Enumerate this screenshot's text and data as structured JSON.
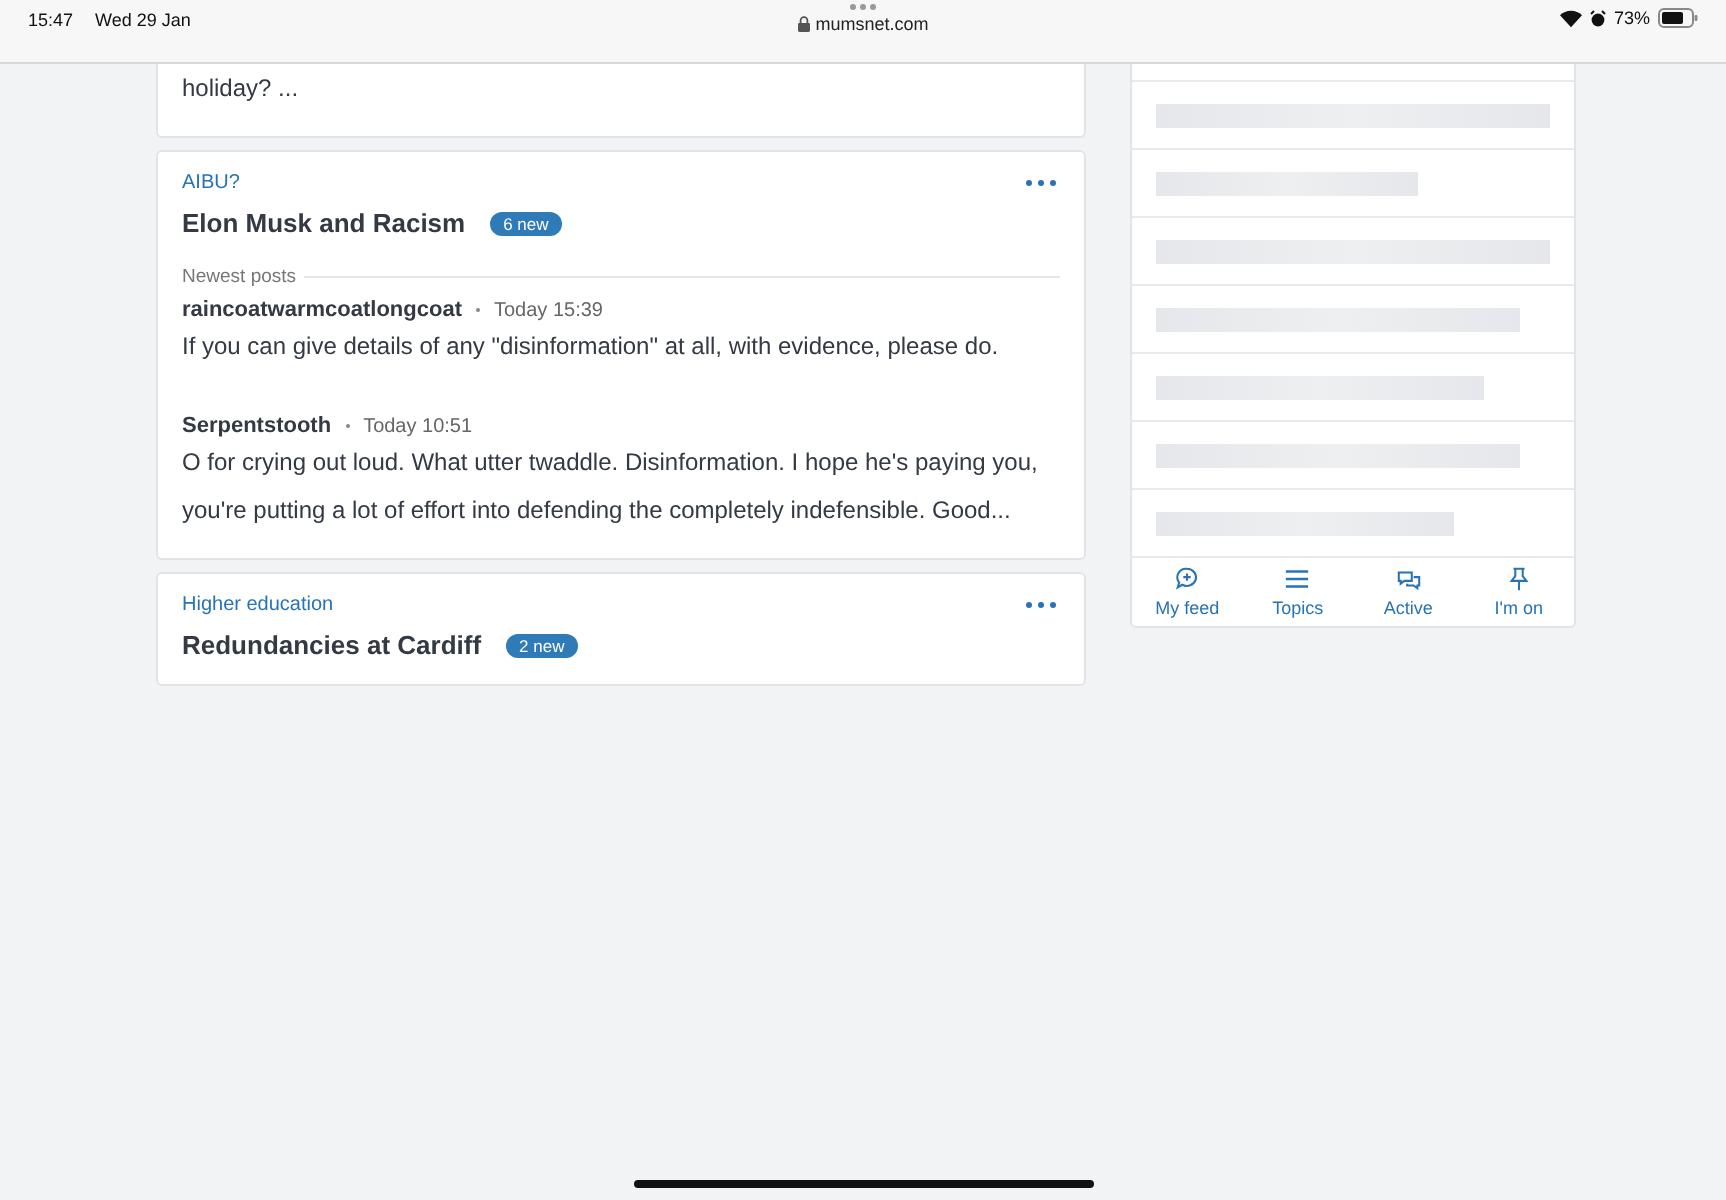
{
  "status_bar": {
    "time": "15:47",
    "date": "Wed 29 Jan",
    "url": "mumsnet.com",
    "battery": "73%"
  },
  "threads": [
    {
      "partial_text": "holiday? ..."
    },
    {
      "topic": "AIBU?",
      "title": "Elon Musk and Racism",
      "badge": "6 new",
      "section_label": "Newest posts",
      "posts": [
        {
          "author": "raincoatwarmcoatlongcoat",
          "time": "Today 15:39",
          "text": "If you can give details of any \"disinformation\" at all, with evidence, please do."
        },
        {
          "author": "Serpentstooth",
          "time": "Today 10:51",
          "text": "O for crying out loud. What utter twaddle. Disinformation. I hope he's paying you, you're putting a lot of effort into defending the completely indefensible. Good..."
        }
      ]
    },
    {
      "topic": "Higher education",
      "title": "Redundancies at Cardiff",
      "badge": "2 new"
    }
  ],
  "bottom_nav": [
    {
      "label": "My feed",
      "kind": "feed"
    },
    {
      "label": "Topics",
      "kind": "topics"
    },
    {
      "label": "Active",
      "kind": "active"
    },
    {
      "label": "I'm on",
      "kind": "pin"
    }
  ]
}
